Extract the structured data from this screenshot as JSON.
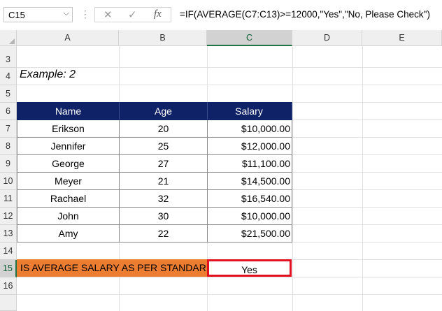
{
  "formula_bar": {
    "cell_reference": "C15",
    "dropdown_icon": "chevron-down-icon",
    "cancel_glyph": "✕",
    "enter_glyph": "✓",
    "fx_label": "fx",
    "formula": "=IF(AVERAGE(C7:C13)>=12000,\"Yes\",\"No, Please Check\")"
  },
  "columns": [
    "A",
    "B",
    "C",
    "D",
    "E"
  ],
  "selected_column": "C",
  "rows": [
    "3",
    "4",
    "5",
    "6",
    "7",
    "8",
    "9",
    "10",
    "11",
    "12",
    "13",
    "14",
    "15",
    "16"
  ],
  "selected_row": "15",
  "example_title": "Example: 2",
  "table": {
    "headers": [
      "Name",
      "Age",
      "Salary"
    ],
    "rows": [
      [
        "Erikson",
        "20",
        "$10,000.00"
      ],
      [
        "Jennifer",
        "25",
        "$12,000.00"
      ],
      [
        "George",
        "27",
        "$11,100.00"
      ],
      [
        "Meyer",
        "21",
        "$14,500.00"
      ],
      [
        "Rachael",
        "32",
        "$16,540.00"
      ],
      [
        "John",
        "30",
        "$10,000.00"
      ],
      [
        "Amy",
        "22",
        "$21,500.00"
      ]
    ]
  },
  "question": "IS AVERAGE SALARY AS PER STANDARD?",
  "answer": "Yes",
  "colors": {
    "header_fill": "#0f2167",
    "question_fill": "#ed7d31",
    "highlight_border": "#e3101f",
    "selection_accent": "#217346"
  }
}
